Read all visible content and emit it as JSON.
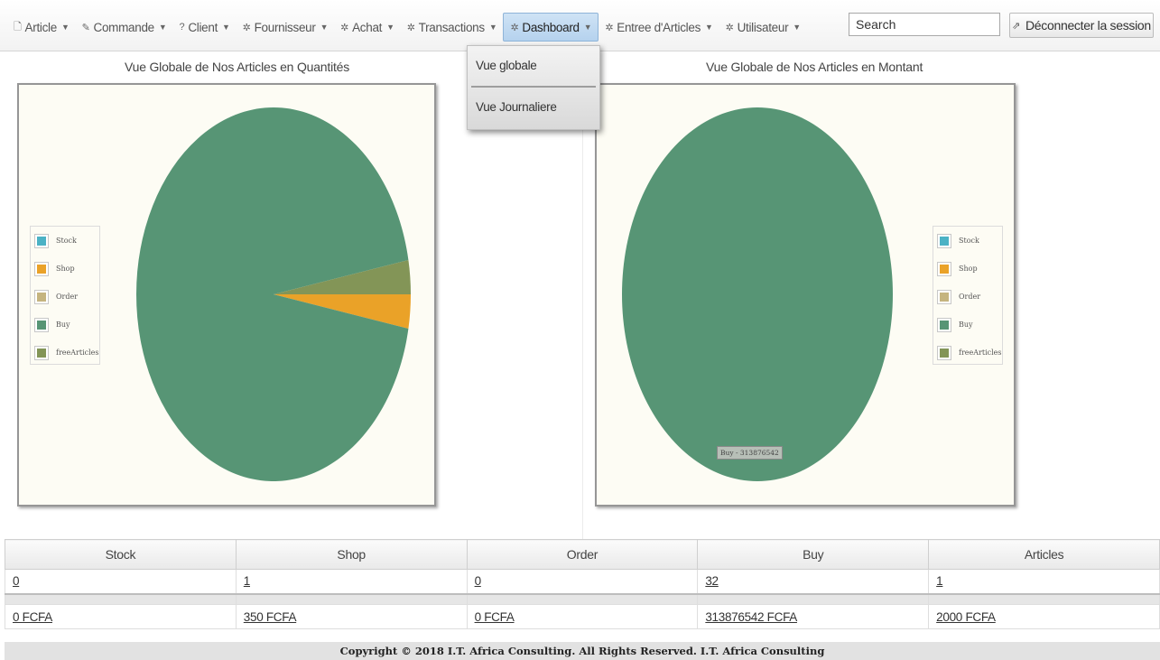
{
  "nav": {
    "items": [
      {
        "icon": "document-icon",
        "glyph": "🗋",
        "label": "Article"
      },
      {
        "icon": "pencil-icon",
        "glyph": "✎",
        "label": "Commande"
      },
      {
        "icon": "question-icon",
        "glyph": "?",
        "label": "Client"
      },
      {
        "icon": "gear-icon",
        "glyph": "✲",
        "label": "Fournisseur"
      },
      {
        "icon": "gear-icon",
        "glyph": "✲",
        "label": "Achat"
      },
      {
        "icon": "gear-icon",
        "glyph": "✲",
        "label": "Transactions"
      },
      {
        "icon": "gear-icon",
        "glyph": "✲",
        "label": "Dashboard",
        "active": true
      },
      {
        "icon": "gear-icon",
        "glyph": "✲",
        "label": "Entree d'Articles"
      },
      {
        "icon": "gear-icon",
        "glyph": "✲",
        "label": "Utilisateur"
      }
    ],
    "search_placeholder": "Search",
    "logout_label": "Déconnecter la session"
  },
  "dropdown": {
    "items": [
      "Vue globale",
      "Vue Journaliere"
    ]
  },
  "charts": {
    "left_title": "Vue Globale de Nos Articles en Quantités",
    "right_title": "Vue Globale de Nos Articles en Montant",
    "tooltip": "Buy - 313876542"
  },
  "chart_data": [
    {
      "type": "pie",
      "title": "Vue Globale de Nos Articles en Quantités",
      "categories": [
        "Stock",
        "Shop",
        "Order",
        "Buy",
        "freeArticles"
      ],
      "values": [
        0,
        1,
        0,
        32,
        1
      ],
      "colors": [
        "#4bb2c5",
        "#eaa228",
        "#c5b47f",
        "#579575",
        "#839557"
      ],
      "legend": "left"
    },
    {
      "type": "pie",
      "title": "Vue Globale de Nos Articles en Montant",
      "categories": [
        "Stock",
        "Shop",
        "Order",
        "Buy",
        "freeArticles"
      ],
      "values": [
        0,
        350,
        0,
        313876542,
        2000
      ],
      "colors": [
        "#4bb2c5",
        "#eaa228",
        "#c5b47f",
        "#579575",
        "#839557"
      ],
      "legend": "right"
    }
  ],
  "table": {
    "headers": [
      "Stock",
      "Shop",
      "Order",
      "Buy",
      "Articles"
    ],
    "counts": [
      "0",
      "1",
      "0",
      "32",
      "1"
    ],
    "amounts": [
      "0 FCFA",
      "350 FCFA",
      "0 FCFA",
      "313876542 FCFA",
      "2000 FCFA"
    ]
  },
  "footer": "Copyright © 2018 I.T. Africa Consulting. All Rights Reserved. I.T. Africa Consulting"
}
